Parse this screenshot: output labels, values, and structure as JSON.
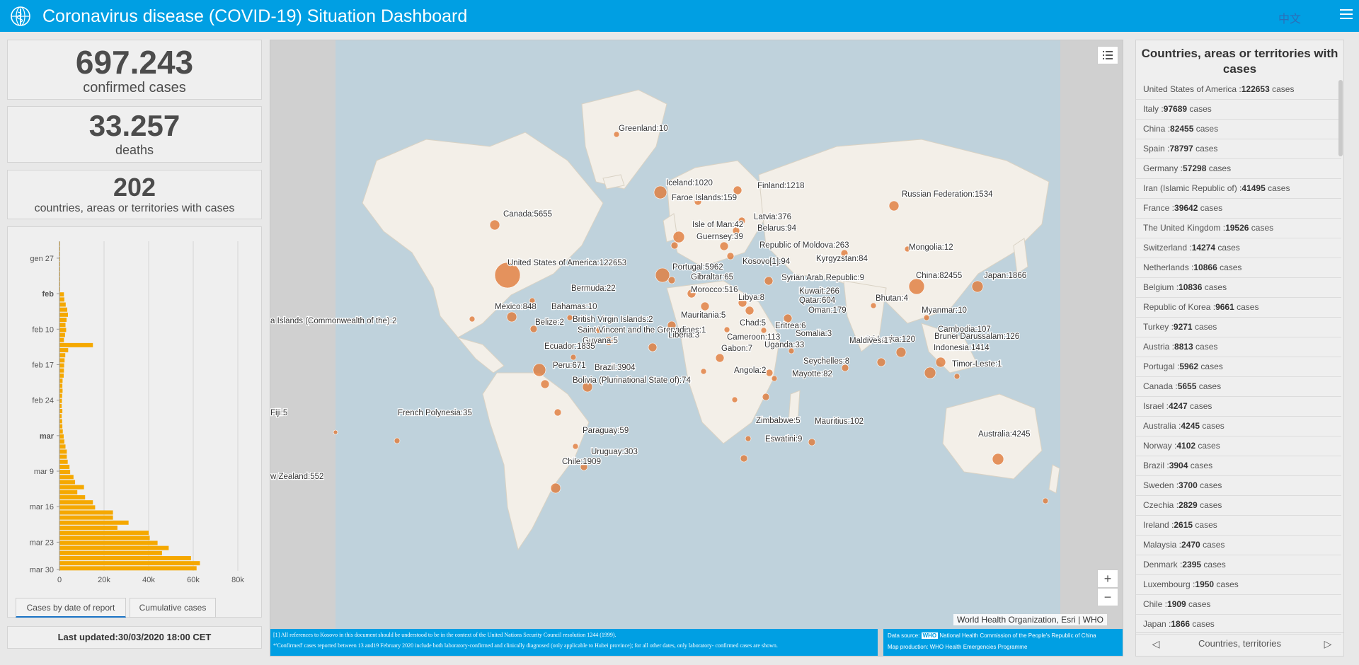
{
  "header": {
    "title": "Coronavirus disease (COVID-19) Situation Dashboard",
    "lang": "中文",
    "brand_color": "#009fe3"
  },
  "stats": {
    "confirmed": {
      "value": "697.243",
      "label": "confirmed cases"
    },
    "deaths": {
      "value": "33.257",
      "label": "deaths"
    },
    "countries": {
      "value": "202",
      "label": "countries, areas or territories with cases"
    }
  },
  "chart_data": {
    "type": "bar",
    "orientation": "horizontal",
    "categories": [
      "gen 27",
      "feb",
      "feb 10",
      "feb 17",
      "feb 24",
      "mar",
      "mar 9",
      "mar 16",
      "mar 23",
      "mar 30"
    ],
    "y_tick_labels": [
      {
        "label": "gen 27",
        "bold": false
      },
      {
        "label": "feb",
        "bold": true
      },
      {
        "label": "feb 10",
        "bold": false
      },
      {
        "label": "feb 17",
        "bold": false
      },
      {
        "label": "feb 24",
        "bold": false
      },
      {
        "label": "mar",
        "bold": true
      },
      {
        "label": "mar 9",
        "bold": false
      },
      {
        "label": "mar 16",
        "bold": false
      },
      {
        "label": "mar 23",
        "bold": false
      },
      {
        "label": "mar 30",
        "bold": false
      }
    ],
    "x_tick_labels": [
      "0",
      "20k",
      "40k",
      "60k",
      "80k"
    ],
    "xlim": [
      0,
      80000
    ],
    "values": [
      1,
      1,
      1,
      1,
      1,
      1,
      1,
      1,
      1,
      1,
      2000,
      2200,
      2800,
      3500,
      3800,
      3200,
      2700,
      3000,
      2500,
      2000,
      15000,
      3900,
      2600,
      2300,
      2100,
      2000,
      1900,
      1400,
      1300,
      1400,
      1200,
      1100,
      1000,
      1300,
      1000,
      1200,
      1300,
      1500,
      1900,
      2200,
      2700,
      3300,
      3300,
      3700,
      4500,
      4800,
      6300,
      7000,
      11000,
      8000,
      11500,
      15000,
      16000,
      24000,
      24000,
      31000,
      26000,
      40000,
      40500,
      44000,
      49000,
      46000,
      59000,
      63000,
      61500
    ],
    "bar_color": "#f5a800",
    "grid": true,
    "tabs": [
      "Cases by date of report",
      "Cumulative cases"
    ],
    "active_tab": 0
  },
  "updated": "Last updated:30/03/2020 18:00 CET",
  "map": {
    "attribution": "World Health Organization, Esri | WHO",
    "footnotes": [
      "[1] All references to Kosovo in this document should be understood to be in the context of the United Nations Security Council resolution 1244 (1999).",
      "*'Confirmed' cases reported between 13 and19 February 2020 include both laboratory-confirmed and clinically diagnosed (only  applicable to Hubei province); for all other dates, only laboratory-  confirmed cases are shown."
    ],
    "source_label": "Data source:",
    "source_tag": "WHO",
    "source_text": "National Health Commission of the People's Republic of China",
    "production": "Map production: WHO Health Emergencies Programme",
    "marker_color": "#e07b39",
    "labels": [
      {
        "text": "Greenland:10"
      },
      {
        "text": "Iceland:1020"
      },
      {
        "text": "Faroe Islands:159"
      },
      {
        "text": "Finland:1218"
      },
      {
        "text": "Russian Federation:1534"
      },
      {
        "text": "Canada:5655"
      },
      {
        "text": "Latvia:376"
      },
      {
        "text": "Isle of Man:42"
      },
      {
        "text": "Belarus:94"
      },
      {
        "text": "Guernsey:39"
      },
      {
        "text": "Republic of Moldova:263"
      },
      {
        "text": "Mongolia:12"
      },
      {
        "text": "United States of America:122653"
      },
      {
        "text": "Kyrgyzstan:84"
      },
      {
        "text": "Portugal:5962"
      },
      {
        "text": "Kosovo[1]:94"
      },
      {
        "text": "China:82455"
      },
      {
        "text": "Japan:1866"
      },
      {
        "text": "Gibraltar:65"
      },
      {
        "text": "Syrian Arab Republic:9"
      },
      {
        "text": "Morocco:516"
      },
      {
        "text": "Bermuda:22"
      },
      {
        "text": "Kuwait:266"
      },
      {
        "text": "Libya:8"
      },
      {
        "text": "Bhutan:4"
      },
      {
        "text": "Qatar:604"
      },
      {
        "text": "Mexico:848"
      },
      {
        "text": "Bahamas:10"
      },
      {
        "text": "Mauritania:5"
      },
      {
        "text": "Oman:179"
      },
      {
        "text": "Myanmar:10"
      },
      {
        "text": "British Virgin Islands:2"
      },
      {
        "text": "a Islands (Commonwealth of the):2"
      },
      {
        "text": "Belize:2"
      },
      {
        "text": "Chad:5"
      },
      {
        "text": "Eritrea:6"
      },
      {
        "text": "Saint Vincent and the Grenadines:1"
      },
      {
        "text": "Cambodia:107"
      },
      {
        "text": "Sri Lanka:120"
      },
      {
        "text": "Brunei Darussalam:126"
      },
      {
        "text": "Liberia:3"
      },
      {
        "text": "Cameroon:113"
      },
      {
        "text": "Somalia:3"
      },
      {
        "text": "Guyana:5"
      },
      {
        "text": "Maldives:17"
      },
      {
        "text": "Indonesia:1414"
      },
      {
        "text": "Ecuador:1835"
      },
      {
        "text": "Gabon:7"
      },
      {
        "text": "Uganda:33"
      },
      {
        "text": "Seychelles:8"
      },
      {
        "text": "Timor-Leste:1"
      },
      {
        "text": "Peru:671"
      },
      {
        "text": "Brazil:3904"
      },
      {
        "text": "Angola:2"
      },
      {
        "text": "Mayotte:82"
      },
      {
        "text": "Bolivia (Plurinational State of):74"
      },
      {
        "text": "Fiji:5"
      },
      {
        "text": "French Polynesia:35"
      },
      {
        "text": "Zimbabwe:5"
      },
      {
        "text": "Mauritius:102"
      },
      {
        "text": "Paraguay:59"
      },
      {
        "text": "Australia:4245"
      },
      {
        "text": "Eswatini:9"
      },
      {
        "text": "Uruguay:303"
      },
      {
        "text": "Chile:1909"
      },
      {
        "text": "w Zealand:552"
      }
    ]
  },
  "list": {
    "title": "Countries, areas or territories with cases",
    "items": [
      {
        "name": "United States of America :",
        "value": "122653",
        "unit": "cases"
      },
      {
        "name": "Italy :",
        "value": "97689",
        "unit": "cases"
      },
      {
        "name": "China :",
        "value": "82455",
        "unit": "cases"
      },
      {
        "name": "Spain :",
        "value": "78797",
        "unit": "cases"
      },
      {
        "name": "Germany :",
        "value": "57298",
        "unit": "cases"
      },
      {
        "name": "Iran (Islamic Republic of) :",
        "value": "41495",
        "unit": "cases"
      },
      {
        "name": "France :",
        "value": "39642",
        "unit": "cases"
      },
      {
        "name": "The United Kingdom :",
        "value": "19526",
        "unit": "cases"
      },
      {
        "name": "Switzerland :",
        "value": "14274",
        "unit": "cases"
      },
      {
        "name": "Netherlands :",
        "value": "10866",
        "unit": "cases"
      },
      {
        "name": "Belgium :",
        "value": "10836",
        "unit": "cases"
      },
      {
        "name": "Republic of Korea :",
        "value": "9661",
        "unit": "cases"
      },
      {
        "name": "Turkey :",
        "value": "9271",
        "unit": "cases"
      },
      {
        "name": "Austria :",
        "value": "8813",
        "unit": "cases"
      },
      {
        "name": "Portugal :",
        "value": "5962",
        "unit": "cases"
      },
      {
        "name": "Canada :",
        "value": "5655",
        "unit": "cases"
      },
      {
        "name": "Israel :",
        "value": "4247",
        "unit": "cases"
      },
      {
        "name": "Australia :",
        "value": "4245",
        "unit": "cases"
      },
      {
        "name": "Norway :",
        "value": "4102",
        "unit": "cases"
      },
      {
        "name": "Brazil :",
        "value": "3904",
        "unit": "cases"
      },
      {
        "name": "Sweden :",
        "value": "3700",
        "unit": "cases"
      },
      {
        "name": "Czechia :",
        "value": "2829",
        "unit": "cases"
      },
      {
        "name": "Ireland :",
        "value": "2615",
        "unit": "cases"
      },
      {
        "name": "Malaysia :",
        "value": "2470",
        "unit": "cases"
      },
      {
        "name": "Denmark :",
        "value": "2395",
        "unit": "cases"
      },
      {
        "name": "Luxembourg :",
        "value": "1950",
        "unit": "cases"
      },
      {
        "name": "Chile :",
        "value": "1909",
        "unit": "cases"
      },
      {
        "name": "Japan :",
        "value": "1866",
        "unit": "cases"
      }
    ],
    "footer": "Countries, territories"
  }
}
